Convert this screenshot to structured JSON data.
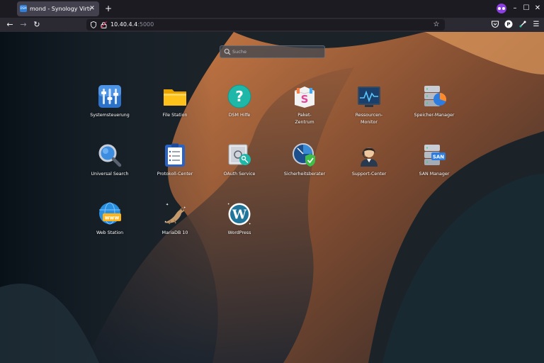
{
  "browser": {
    "tab": {
      "title": "mond - Synology VirtualDSM",
      "favicon_text": "DSM",
      "close_label": "✕"
    },
    "new_tab_label": "+",
    "window_controls": {
      "minimize": "–",
      "maximize": "☐",
      "close": "✕"
    },
    "url": {
      "host": "10.40.4.4",
      "port": ":5000"
    },
    "icons": {
      "back": "back-arrow-icon",
      "forward": "forward-arrow-icon",
      "reload": "reload-icon",
      "shield": "tracking-protection-icon",
      "lock": "insecure-lock-icon",
      "star": "bookmark-star-icon",
      "pocket": "pocket-icon",
      "extension_p": "extension-icon",
      "extension_badge": "privacy-extension-icon",
      "menu": "hamburger-menu-icon"
    }
  },
  "desktop": {
    "search": {
      "placeholder": "Suche"
    },
    "apps": [
      {
        "key": "systemsteuerung",
        "label": "Systemsteuerung",
        "icon": "control-panel-icon"
      },
      {
        "key": "file-station",
        "label": "File Station",
        "icon": "folder-icon"
      },
      {
        "key": "dsm-hilfe",
        "label": "DSM Hilfe",
        "icon": "help-icon"
      },
      {
        "key": "paket-zentrum",
        "label": "Paket-\nZentrum",
        "icon": "package-center-icon"
      },
      {
        "key": "ressourcen-monitor",
        "label": "Ressourcen-\nMonitor",
        "icon": "resource-monitor-icon"
      },
      {
        "key": "speicher-manager",
        "label": "Speicher-Manager",
        "icon": "storage-manager-icon"
      },
      {
        "key": "universal-search",
        "label": "Universal Search",
        "icon": "magnifier-icon"
      },
      {
        "key": "protokoll-center",
        "label": "Protokoll-Center",
        "icon": "log-center-icon"
      },
      {
        "key": "oauth-service",
        "label": "OAuth Service",
        "icon": "oauth-safe-icon"
      },
      {
        "key": "sicherheitsberater",
        "label": "Sicherheitsberater",
        "icon": "security-advisor-icon"
      },
      {
        "key": "support-center",
        "label": "Support-Center",
        "icon": "support-agent-icon"
      },
      {
        "key": "san-manager",
        "label": "SAN Manager",
        "icon": "san-manager-icon"
      },
      {
        "key": "web-station",
        "label": "Web Station",
        "icon": "web-station-icon"
      },
      {
        "key": "mariadb",
        "label": "MariaDB 10",
        "icon": "mariadb-seal-icon"
      },
      {
        "key": "wordpress",
        "label": "WordPress",
        "icon": "wordpress-icon"
      }
    ]
  }
}
